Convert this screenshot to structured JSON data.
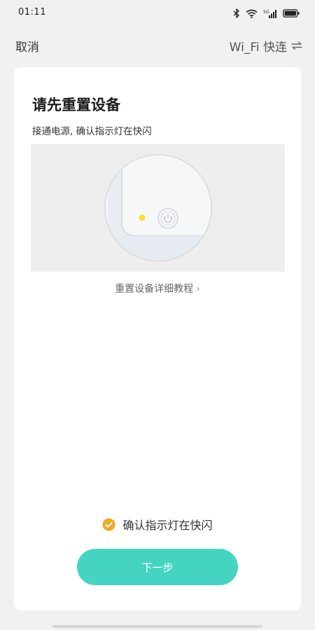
{
  "status_bar": {
    "time": "01:11",
    "icons": [
      "bluetooth-icon",
      "wifi-icon",
      "signal-icon",
      "battery-icon"
    ]
  },
  "nav": {
    "cancel_label": "取消",
    "mode_label": "Wi_Fi 快连",
    "mode_icon": "switch-arrows-icon"
  },
  "card": {
    "title": "请先重置设备",
    "subtitle": "接通电源, 确认指示灯在快闪",
    "illustration_icon": "power-icon",
    "indicator_color": "#f6e22a",
    "tutorial_link": "重置设备详细教程",
    "confirm_label": "确认指示灯在快闪",
    "confirm_checked": true,
    "next_button": "下一步"
  },
  "colors": {
    "accent": "#46d4c2",
    "check": "#f0a826",
    "background": "#f1f1f1"
  }
}
